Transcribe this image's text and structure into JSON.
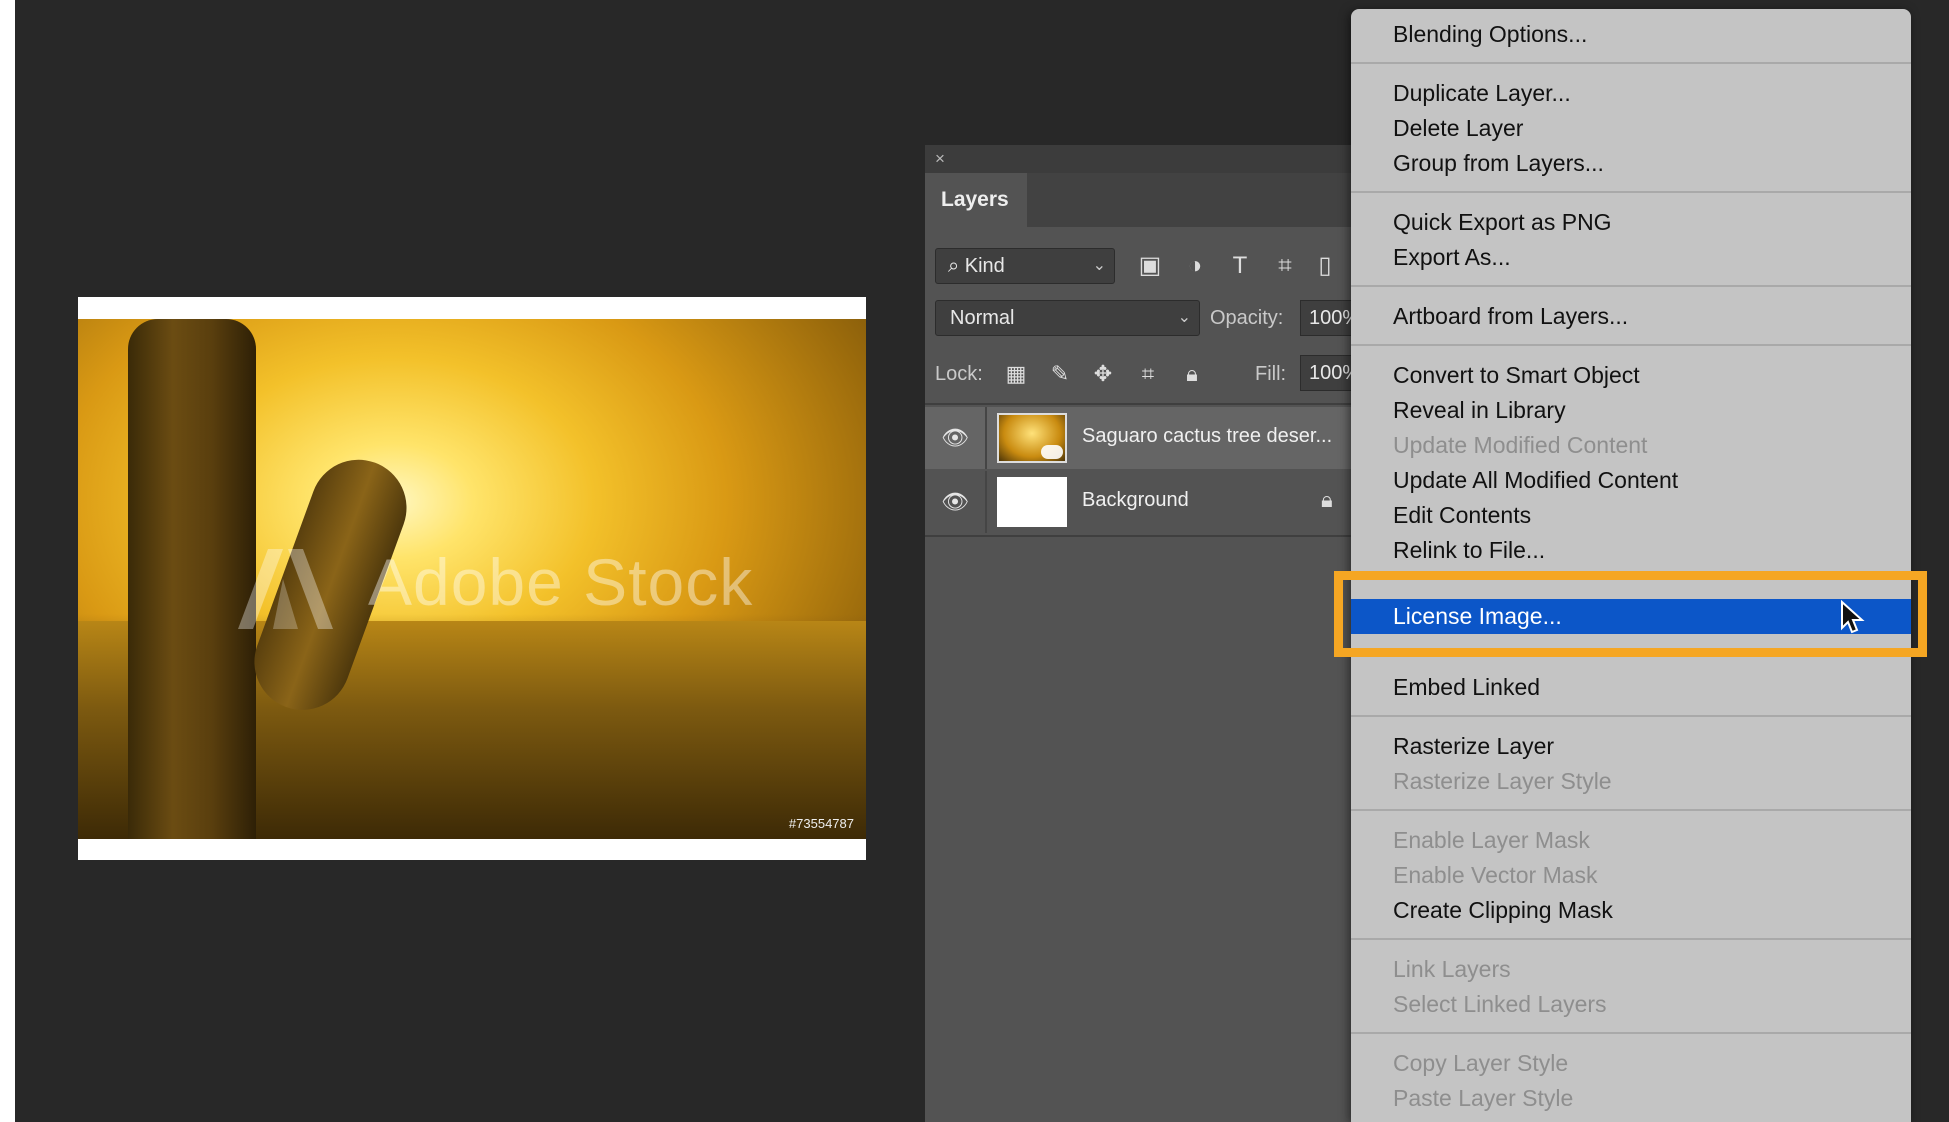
{
  "document": {
    "watermark": "Adobe Stock",
    "stock_id": "#73554787"
  },
  "layers_panel": {
    "close_glyph": "×",
    "tab_label": "Layers",
    "kind_label": "Kind",
    "blend_mode": "Normal",
    "opacity_label": "Opacity:",
    "opacity_value": "100%",
    "lock_label": "Lock:",
    "fill_label": "Fill:",
    "fill_value": "100%",
    "layers": [
      {
        "name": "Saguaro cactus tree deser...",
        "selected": true
      },
      {
        "name": "Background",
        "selected": false,
        "locked": true
      }
    ]
  },
  "context_menu": {
    "items": [
      {
        "label": "Blending Options...",
        "enabled": true
      },
      {
        "label": "Duplicate Layer...",
        "enabled": true
      },
      {
        "label": "Delete Layer",
        "enabled": true
      },
      {
        "label": "Group from Layers...",
        "enabled": true
      },
      {
        "label": "Quick Export as PNG",
        "enabled": true
      },
      {
        "label": "Export As...",
        "enabled": true
      },
      {
        "label": "Artboard from Layers...",
        "enabled": true
      },
      {
        "label": "Convert to Smart Object",
        "enabled": true
      },
      {
        "label": "Reveal in Library",
        "enabled": true
      },
      {
        "label": "Update Modified Content",
        "enabled": false
      },
      {
        "label": "Update All Modified Content",
        "enabled": true
      },
      {
        "label": "Edit Contents",
        "enabled": true
      },
      {
        "label": "Relink to File...",
        "enabled": true
      },
      {
        "label": "License Image...",
        "enabled": true,
        "highlighted": true
      },
      {
        "label": "Embed Linked",
        "enabled": true
      },
      {
        "label": "Rasterize Layer",
        "enabled": true
      },
      {
        "label": "Rasterize Layer Style",
        "enabled": false
      },
      {
        "label": "Enable Layer Mask",
        "enabled": false
      },
      {
        "label": "Enable Vector Mask",
        "enabled": false
      },
      {
        "label": "Create Clipping Mask",
        "enabled": true
      },
      {
        "label": "Link Layers",
        "enabled": false
      },
      {
        "label": "Select Linked Layers",
        "enabled": false
      },
      {
        "label": "Copy Layer Style",
        "enabled": false
      },
      {
        "label": "Paste Layer Style",
        "enabled": false
      }
    ]
  },
  "colors": {
    "menu_highlight": "#0c56c8",
    "callout_frame": "#f5a623"
  }
}
